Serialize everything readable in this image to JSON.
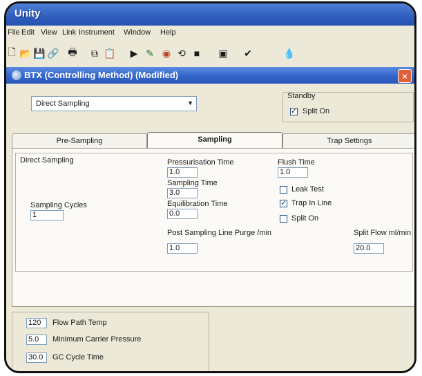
{
  "app": {
    "title": "Unity"
  },
  "menu": [
    "File",
    "Edit",
    "View",
    "Link",
    "Instrument",
    "Window",
    "Help"
  ],
  "toolbar": {
    "icons": [
      "new-file-icon",
      "open-folder-icon",
      "save-icon",
      "link-icon",
      "print-icon",
      "copy-icon",
      "paste-icon",
      "play-icon",
      "edit-icon",
      "stop-icon",
      "refresh-icon",
      "square-icon",
      "monitor-icon",
      "check-icon",
      "drops-icon"
    ]
  },
  "dialog": {
    "title": "BTX (Controlling Method) (Modified)",
    "method_select": "Direct Sampling",
    "standby_label": "Standby",
    "standby_split_on_label": "Split On",
    "standby_split_on_checked": true
  },
  "tabs": [
    {
      "label": "Pre-Sampling",
      "active": false
    },
    {
      "label": "Sampling",
      "active": true
    },
    {
      "label": "Trap Settings",
      "active": false
    }
  ],
  "sampling": {
    "group_label": "Direct Sampling",
    "pressurisation_time_label": "Pressurisation Time",
    "pressurisation_time": "1.0",
    "sampling_time_label": "Sampling Time",
    "sampling_time": "3.0",
    "equilibration_time_label": "Equilibration Time",
    "equilibration_time": "0.0",
    "flush_time_label": "Flush Time",
    "flush_time": "1.0",
    "leak_test_label": "Leak Test",
    "leak_test_checked": false,
    "trap_in_line_label": "Trap In Line",
    "trap_in_line_checked": true,
    "split_on_label": "Split On",
    "split_on_checked": false,
    "sampling_cycles_label": "Sampling Cycles",
    "sampling_cycles": "1",
    "post_purge_label": "Post Sampling Line Purge /min",
    "post_purge": "1.0",
    "split_flow_label": "Split Flow ml/min",
    "split_flow": "20.0"
  },
  "bottom": {
    "flow_path_temp": "120",
    "flow_path_temp_label": "Flow Path Temp",
    "min_carrier_pressure": "5.0",
    "min_carrier_pressure_label": "Minimum Carrier Pressure",
    "gc_cycle_time": "30.0",
    "gc_cycle_time_label": "GC Cycle Time"
  }
}
